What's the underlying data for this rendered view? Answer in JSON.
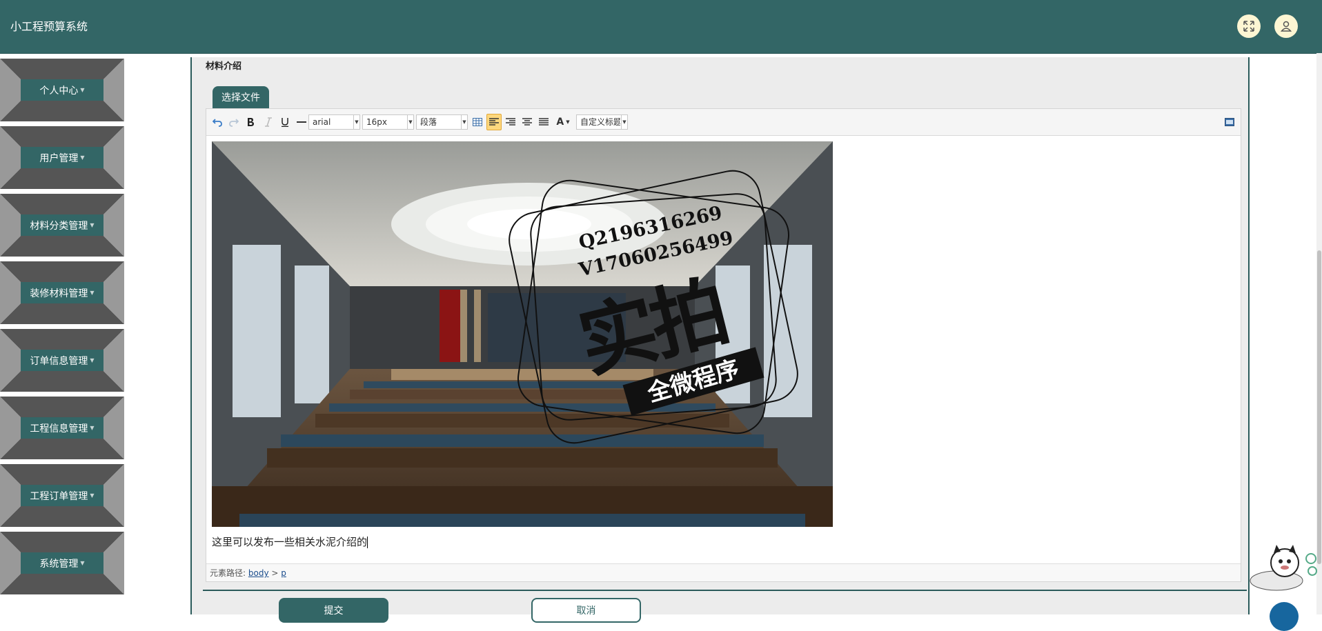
{
  "header": {
    "title": "小工程预算系统",
    "fullscreen_icon": "expand-icon",
    "user_icon": "user-icon"
  },
  "sidebar": {
    "items": [
      {
        "label": "个人中心"
      },
      {
        "label": "用户管理"
      },
      {
        "label": "材料分类管理"
      },
      {
        "label": "装修材料管理"
      },
      {
        "label": "订单信息管理"
      },
      {
        "label": "工程信息管理"
      },
      {
        "label": "工程订单管理"
      },
      {
        "label": "系统管理"
      }
    ]
  },
  "form": {
    "field_label": "材料介绍",
    "choose_file": "选择文件",
    "editor": {
      "toolbar": {
        "font_family": "arial",
        "font_size": "16px",
        "paragraph": "段落",
        "font_color_glyph": "A",
        "custom_title": "自定义标题"
      },
      "watermark": {
        "line1": "Q2196316269",
        "line2": "V17060256499",
        "main": "实拍",
        "banner": "全微程序"
      },
      "content_text": "这里可以发布一些相关水泥介绍的",
      "statusbar": {
        "prefix": "元素路径:",
        "path_body": "body",
        "separator": ">",
        "path_p": "p"
      }
    },
    "submit": "提交",
    "cancel": "取消"
  },
  "colors": {
    "primary": "#336666",
    "sidebar_trapezoid": "#555555",
    "accent_active": "#fdd77d"
  }
}
